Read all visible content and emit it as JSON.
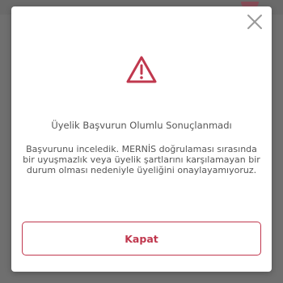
{
  "colors": {
    "accent": "#c0384e",
    "text": "#555555",
    "overlay": "#6f6f6f",
    "close_icon": "#9a9a9a"
  },
  "icons": {
    "close": "close-icon",
    "warning": "warning-triangle-icon"
  },
  "dialog": {
    "title": "Üyelik Başvurun Olumlu Sonuçlanmadı",
    "message": "Başvurunu inceledik. MERNİS doğrulaması sırasında bir uyuşmazlık veya üyelik şartlarını karşılamayan bir durum olması nedeniyle üyeliğini onaylayamıyoruz.",
    "button_label": "Kapat"
  }
}
